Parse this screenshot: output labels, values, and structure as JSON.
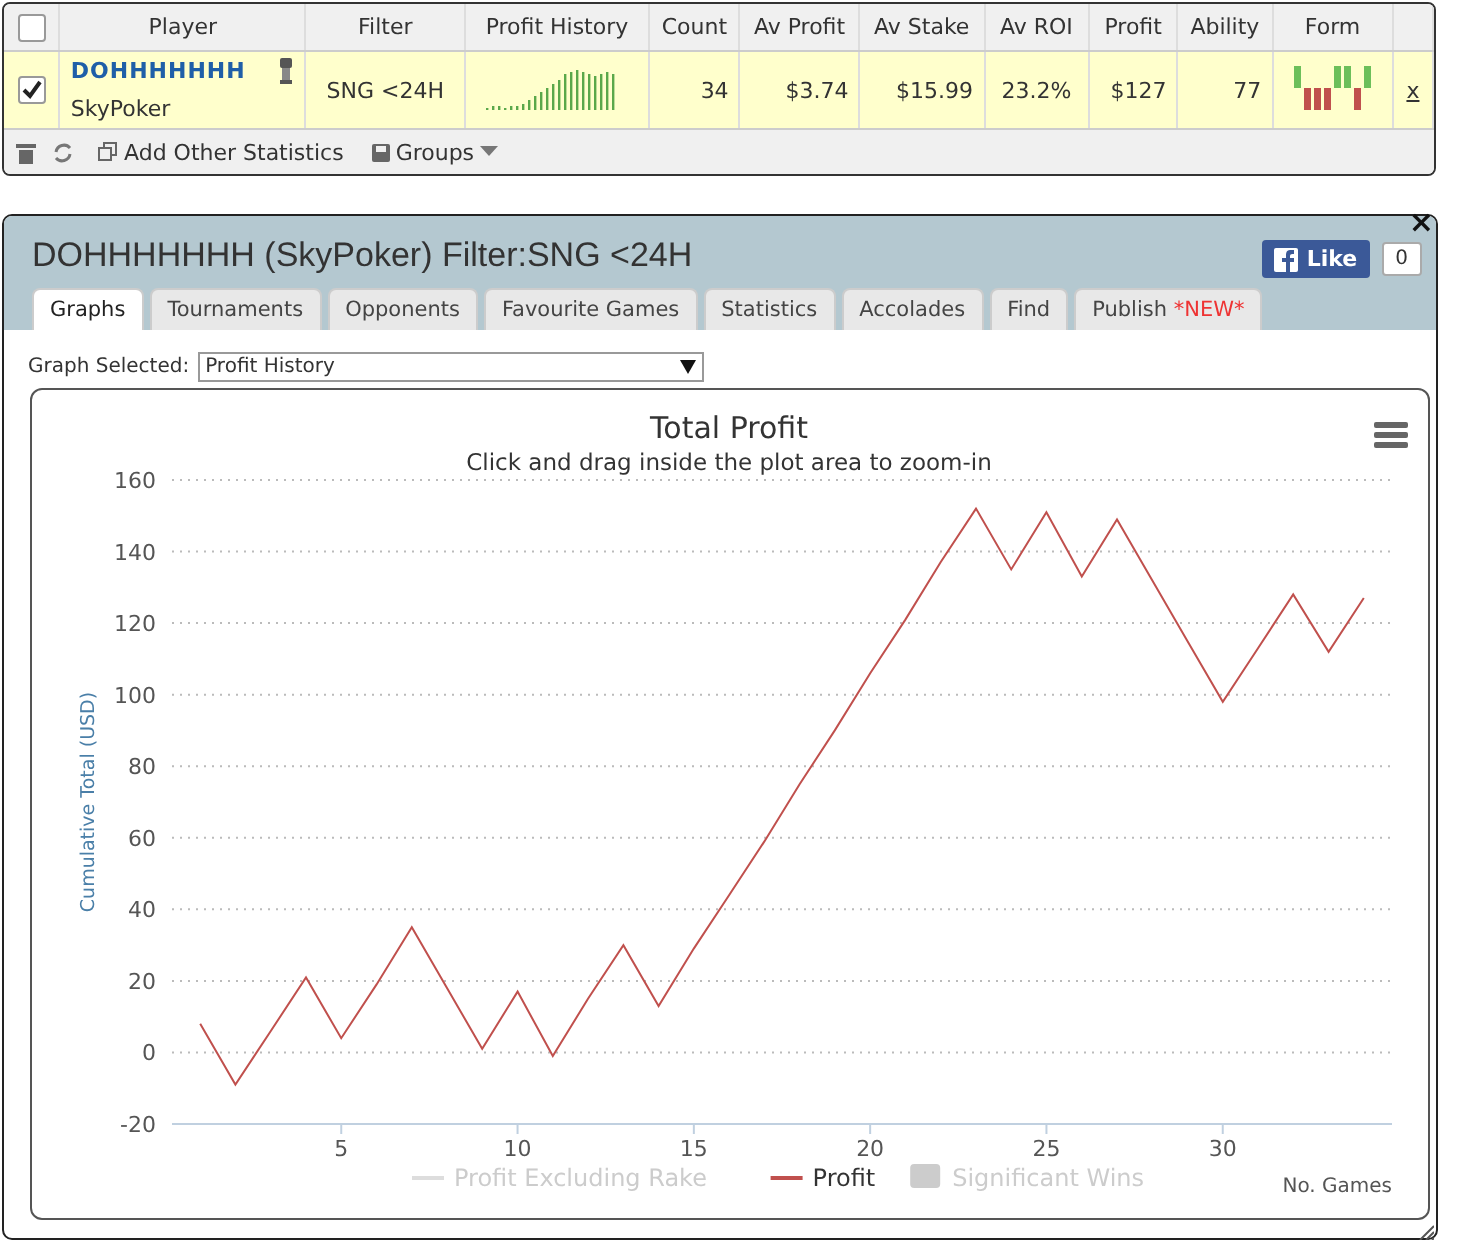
{
  "stats_table": {
    "columns": [
      "Player",
      "Filter",
      "Profit History",
      "Count",
      "Av Profit",
      "Av Stake",
      "Av ROI",
      "Profit",
      "Ability",
      "Form"
    ],
    "rows": [
      {
        "checked": true,
        "player": "DOHHHHHHH",
        "site": "SkyPoker",
        "filter": "SNG <24H",
        "count": "34",
        "av_profit": "$3.74",
        "av_stake": "$15.99",
        "av_roi": "23.2%",
        "profit": "$127",
        "ability": "77",
        "form": [
          {
            "won": true
          },
          {
            "won": false
          },
          {
            "won": false
          },
          {
            "won": false
          },
          {
            "won": true
          },
          {
            "won": true
          },
          {
            "won": false
          },
          {
            "won": true
          }
        ],
        "remove": "x"
      }
    ],
    "header_checked": false,
    "toolbar": {
      "add": "Add Other Statistics",
      "groups": "Groups"
    }
  },
  "dialog": {
    "title": "DOHHHHHHH (SkyPoker) Filter:SNG <24H",
    "close": "×",
    "like": "Like",
    "like_count": "0",
    "tabs": [
      {
        "label": "Graphs",
        "selected": true
      },
      {
        "label": "Tournaments",
        "selected": false
      },
      {
        "label": "Opponents",
        "selected": false
      },
      {
        "label": "Favourite Games",
        "selected": false
      },
      {
        "label": "Statistics",
        "selected": false
      },
      {
        "label": "Accolades",
        "selected": false
      },
      {
        "label": "Find",
        "selected": false
      },
      {
        "label": "Publish",
        "badge": "*NEW*",
        "selected": false
      }
    ],
    "graph_select": {
      "label": "Graph Selected:",
      "value": "Profit History"
    },
    "chart": {
      "subtitle": "Click and drag inside the plot area to zoom-in",
      "legend": [
        {
          "label": "Profit Excluding Rake",
          "kind": "line",
          "visible": false
        },
        {
          "kind": "line",
          "visible": true
        },
        {
          "label": "Significant Wins",
          "kind": "area",
          "visible": false
        }
      ],
      "chart_data": {
        "type": "line",
        "title": "Total Profit",
        "xlabel": "No. Games",
        "ylabel": "Cumulative Total (USD)",
        "x": [
          1,
          2,
          3,
          4,
          5,
          6,
          7,
          8,
          9,
          10,
          11,
          12,
          13,
          14,
          15,
          16,
          17,
          18,
          19,
          20,
          21,
          22,
          23,
          24,
          25,
          26,
          27,
          28,
          29,
          30,
          31,
          32,
          33,
          34
        ],
        "series": [
          {
            "name": "Profit",
            "color": "#c0504d",
            "values": [
              8,
              -9,
              6,
              21,
              4,
              19,
              35,
              18,
              1,
              17,
              -1,
              15,
              30,
              13,
              29,
              44,
              59,
              75,
              90,
              106,
              121,
              137,
              152,
              135,
              151,
              133,
              149,
              132,
              115,
              98,
              113,
              128,
              112,
              127
            ]
          }
        ],
        "grid": true,
        "xlim": [
          0.2,
          34.8
        ],
        "ylim": [
          -20,
          160
        ],
        "xticks": [
          5,
          10,
          15,
          20,
          25,
          30
        ],
        "yticks": [
          -20,
          0,
          20,
          40,
          60,
          80,
          100,
          120,
          140,
          160
        ]
      }
    }
  }
}
